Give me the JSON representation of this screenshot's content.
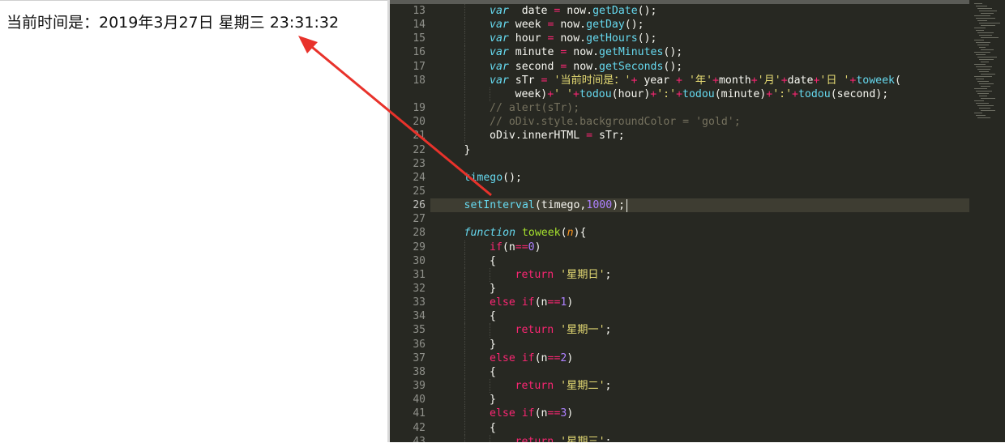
{
  "browser": {
    "time_text": "当前时间是：2019年3月27日 星期三 23:31:32"
  },
  "editor": {
    "active_line": "26",
    "lines": [
      {
        "no": "13",
        "tokens": [
          [
            "kw",
            "var"
          ],
          [
            "",
            "  date "
          ],
          [
            "op",
            "="
          ],
          [
            "",
            " now."
          ],
          [
            "fn",
            "getDate"
          ],
          [
            "",
            "();"
          ]
        ],
        "indent": 2
      },
      {
        "no": "14",
        "tokens": [
          [
            "kw",
            "var"
          ],
          [
            "",
            " week "
          ],
          [
            "op",
            "="
          ],
          [
            "",
            " now."
          ],
          [
            "fn",
            "getDay"
          ],
          [
            "",
            "();"
          ]
        ],
        "indent": 2
      },
      {
        "no": "15",
        "tokens": [
          [
            "kw",
            "var"
          ],
          [
            "",
            " hour "
          ],
          [
            "op",
            "="
          ],
          [
            "",
            " now."
          ],
          [
            "fn",
            "getHours"
          ],
          [
            "",
            "();"
          ]
        ],
        "indent": 2
      },
      {
        "no": "16",
        "tokens": [
          [
            "kw",
            "var"
          ],
          [
            "",
            " minute "
          ],
          [
            "op",
            "="
          ],
          [
            "",
            " now."
          ],
          [
            "fn",
            "getMinutes"
          ],
          [
            "",
            "();"
          ]
        ],
        "indent": 2
      },
      {
        "no": "17",
        "tokens": [
          [
            "kw",
            "var"
          ],
          [
            "",
            " second "
          ],
          [
            "op",
            "="
          ],
          [
            "",
            " now."
          ],
          [
            "fn",
            "getSeconds"
          ],
          [
            "",
            "();"
          ]
        ],
        "indent": 2
      },
      {
        "no": "18",
        "tokens": [
          [
            "kw",
            "var"
          ],
          [
            "",
            " sTr "
          ],
          [
            "op",
            "="
          ],
          [
            "",
            " "
          ],
          [
            "str",
            "'当前时间是：'"
          ],
          [
            "op",
            "+"
          ],
          [
            "",
            " year "
          ],
          [
            "op",
            "+"
          ],
          [
            "",
            " "
          ],
          [
            "str",
            "'年'"
          ],
          [
            "op",
            "+"
          ],
          [
            "",
            "month"
          ],
          [
            "op",
            "+"
          ],
          [
            "str",
            "'月'"
          ],
          [
            "op",
            "+"
          ],
          [
            "",
            "date"
          ],
          [
            "op",
            "+"
          ],
          [
            "str",
            "'日 '"
          ],
          [
            "op",
            "+"
          ],
          [
            "fn",
            "toweek"
          ],
          [
            "",
            "("
          ]
        ],
        "indent": 2
      },
      {
        "no": "",
        "tokens": [
          [
            "",
            "week)"
          ],
          [
            "op",
            "+"
          ],
          [
            "str",
            "' '"
          ],
          [
            "op",
            "+"
          ],
          [
            "fn",
            "todou"
          ],
          [
            "",
            "(hour)"
          ],
          [
            "op",
            "+"
          ],
          [
            "str",
            "':'"
          ],
          [
            "op",
            "+"
          ],
          [
            "fn",
            "todou"
          ],
          [
            "",
            "(minute)"
          ],
          [
            "op",
            "+"
          ],
          [
            "str",
            "':'"
          ],
          [
            "op",
            "+"
          ],
          [
            "fn",
            "todou"
          ],
          [
            "",
            "(second);"
          ]
        ],
        "indent": 3
      },
      {
        "no": "19",
        "tokens": [
          [
            "cm",
            "// alert(sTr);"
          ]
        ],
        "indent": 2
      },
      {
        "no": "20",
        "tokens": [
          [
            "cm",
            "// oDiv.style.backgroundColor = 'gold';"
          ]
        ],
        "indent": 2
      },
      {
        "no": "21",
        "tokens": [
          [
            "",
            "oDiv.innerHTML "
          ],
          [
            "op",
            "="
          ],
          [
            "",
            " sTr;"
          ]
        ],
        "indent": 2
      },
      {
        "no": "22",
        "tokens": [
          [
            "",
            "}"
          ]
        ],
        "indent": 1
      },
      {
        "no": "23",
        "tokens": [],
        "indent": 1
      },
      {
        "no": "24",
        "tokens": [
          [
            "fn",
            "timego"
          ],
          [
            "",
            "();"
          ]
        ],
        "indent": 1
      },
      {
        "no": "25",
        "tokens": [],
        "indent": 1
      },
      {
        "no": "26",
        "tokens": [
          [
            "fn",
            "setInterval"
          ],
          [
            "",
            "(timego,"
          ],
          [
            "num",
            "1000"
          ],
          [
            "",
            "); "
          ]
        ],
        "indent": 1
      },
      {
        "no": "27",
        "tokens": [],
        "indent": 1
      },
      {
        "no": "28",
        "tokens": [
          [
            "kw",
            "function"
          ],
          [
            "",
            " "
          ],
          [
            "fname",
            "toweek"
          ],
          [
            "",
            "("
          ],
          [
            "param",
            "n"
          ],
          [
            "",
            "){"
          ]
        ],
        "indent": 1
      },
      {
        "no": "29",
        "tokens": [
          [
            "cl",
            "if"
          ],
          [
            "",
            "(n"
          ],
          [
            "op",
            "=="
          ],
          [
            "num",
            "0"
          ],
          [
            "",
            ")"
          ]
        ],
        "indent": 2
      },
      {
        "no": "30",
        "tokens": [
          [
            "",
            "{"
          ]
        ],
        "indent": 2
      },
      {
        "no": "31",
        "tokens": [
          [
            "cl",
            "return"
          ],
          [
            "",
            " "
          ],
          [
            "str",
            "'星期日'"
          ],
          [
            "",
            ";"
          ]
        ],
        "indent": 3
      },
      {
        "no": "32",
        "tokens": [
          [
            "",
            "}"
          ]
        ],
        "indent": 2
      },
      {
        "no": "33",
        "tokens": [
          [
            "cl",
            "else"
          ],
          [
            "",
            " "
          ],
          [
            "cl",
            "if"
          ],
          [
            "",
            "(n"
          ],
          [
            "op",
            "=="
          ],
          [
            "num",
            "1"
          ],
          [
            "",
            ")"
          ]
        ],
        "indent": 2
      },
      {
        "no": "34",
        "tokens": [
          [
            "",
            "{"
          ]
        ],
        "indent": 2
      },
      {
        "no": "35",
        "tokens": [
          [
            "cl",
            "return"
          ],
          [
            "",
            " "
          ],
          [
            "str",
            "'星期一'"
          ],
          [
            "",
            ";"
          ]
        ],
        "indent": 3
      },
      {
        "no": "36",
        "tokens": [
          [
            "",
            "}"
          ]
        ],
        "indent": 2
      },
      {
        "no": "37",
        "tokens": [
          [
            "cl",
            "else"
          ],
          [
            "",
            " "
          ],
          [
            "cl",
            "if"
          ],
          [
            "",
            "(n"
          ],
          [
            "op",
            "=="
          ],
          [
            "num",
            "2"
          ],
          [
            "",
            ")"
          ]
        ],
        "indent": 2
      },
      {
        "no": "38",
        "tokens": [
          [
            "",
            "{"
          ]
        ],
        "indent": 2
      },
      {
        "no": "39",
        "tokens": [
          [
            "cl",
            "return"
          ],
          [
            "",
            " "
          ],
          [
            "str",
            "'星期二'"
          ],
          [
            "",
            ";"
          ]
        ],
        "indent": 3
      },
      {
        "no": "40",
        "tokens": [
          [
            "",
            "}"
          ]
        ],
        "indent": 2
      },
      {
        "no": "41",
        "tokens": [
          [
            "cl",
            "else"
          ],
          [
            "",
            " "
          ],
          [
            "cl",
            "if"
          ],
          [
            "",
            "(n"
          ],
          [
            "op",
            "=="
          ],
          [
            "num",
            "3"
          ],
          [
            "",
            ")"
          ]
        ],
        "indent": 2
      },
      {
        "no": "42",
        "tokens": [
          [
            "",
            "{"
          ]
        ],
        "indent": 2
      },
      {
        "no": "43",
        "tokens": [
          [
            "cl",
            "return"
          ],
          [
            "",
            " "
          ],
          [
            "str",
            "'星期三'"
          ],
          [
            "",
            ";"
          ]
        ],
        "indent": 3
      }
    ]
  },
  "annotation": {
    "arrow_color": "#e8322b",
    "icon": "arrow-annotation-icon"
  }
}
